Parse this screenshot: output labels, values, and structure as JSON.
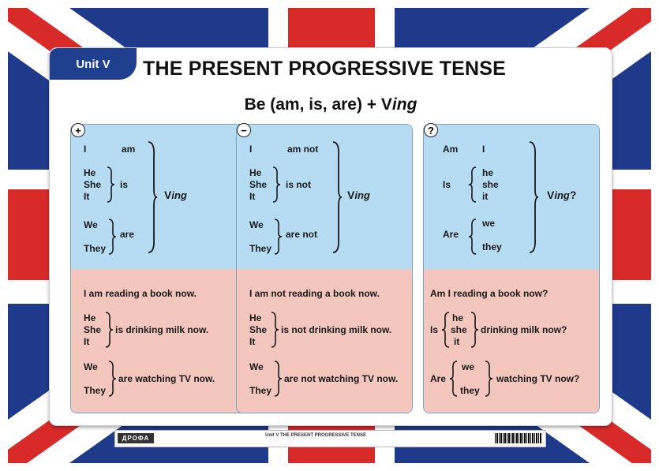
{
  "header": {
    "unit": "Unit V",
    "title": "THE PRESENT PROGRESSIVE TENSE"
  },
  "formula": {
    "main": "Be (am, is, are) + V",
    "suffix": "ing"
  },
  "panels": [
    {
      "sign": "+",
      "pronouns": {
        "i": "I",
        "he": "He",
        "she": "She",
        "it": "It",
        "we": "We",
        "they": "They"
      },
      "verbs": {
        "am": "am",
        "is": "is",
        "are": "are"
      },
      "result": {
        "v": "V",
        "ing": "ing",
        "tail": ""
      },
      "ex1": "I am reading a book now.",
      "ex2_pron": [
        "He",
        "She",
        "It"
      ],
      "ex2_rest": "is drinking milk now.",
      "ex3_pron": [
        "We",
        "They"
      ],
      "ex3_rest": "are watching TV now."
    },
    {
      "sign": "−",
      "pronouns": {
        "i": "I",
        "he": "He",
        "she": "She",
        "it": "It",
        "we": "We",
        "they": "They"
      },
      "verbs": {
        "am": "am not",
        "is": "is not",
        "are": "are not"
      },
      "result": {
        "v": "V",
        "ing": "ing",
        "tail": ""
      },
      "ex1": "I am not reading a book now.",
      "ex2_pron": [
        "He",
        "She",
        "It"
      ],
      "ex2_rest": "is not  drinking milk now.",
      "ex3_pron": [
        "We",
        "They"
      ],
      "ex3_rest": "are not  watching TV now."
    },
    {
      "sign": "?",
      "verbs": {
        "am": "Am",
        "is": "Is",
        "are": "Are"
      },
      "pronouns": {
        "i": "I",
        "he": "he",
        "she": "she",
        "it": "it",
        "we": "we",
        "they": "they"
      },
      "result": {
        "v": "V",
        "ing": "ing",
        "tail": "?"
      },
      "ex1": "Am I reading a book now?",
      "ex2_verb": "Is",
      "ex2_pron": [
        "he",
        "she",
        "it"
      ],
      "ex2_rest": "drinking milk now?",
      "ex3_verb": "Are",
      "ex3_pron": [
        "we",
        "they"
      ],
      "ex3_rest": "watching TV now?"
    }
  ],
  "footer": {
    "publisher": "ДРОФА",
    "unit_caption": "Unit V  THE PRESENT PROGRESSIVE TENSE"
  },
  "colors": {
    "flag_blue": "#1f3a8a",
    "flag_red": "#d92a2a",
    "panel_blue": "#b6dcf4",
    "panel_pink": "#f3c7bd"
  }
}
